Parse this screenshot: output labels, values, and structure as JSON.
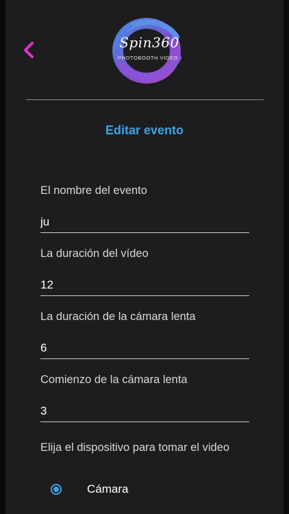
{
  "header": {
    "logo_title": "Spin360",
    "logo_subtitle": "PHOTOBOOTH VIDEO"
  },
  "page": {
    "title": "Editar evento"
  },
  "form": {
    "event_name": {
      "label": "El nombre del evento",
      "value": "ju"
    },
    "video_duration": {
      "label": "La duración del vídeo",
      "value": "12"
    },
    "slowmo_duration": {
      "label": "La duración de la cámara lenta",
      "value": "6"
    },
    "slowmo_start": {
      "label": "Comienzo de la cámara lenta",
      "value": "3"
    },
    "device": {
      "label": "Elija el dispositivo para tomar el video",
      "option_camera": "Cámara"
    }
  },
  "colors": {
    "accent": "#3ea3e0",
    "back_arrow": "#e52fd3",
    "background": "#1d1d1f"
  },
  "icons": {
    "back": "chevron-left-icon",
    "radio": "radio-selected-icon"
  }
}
